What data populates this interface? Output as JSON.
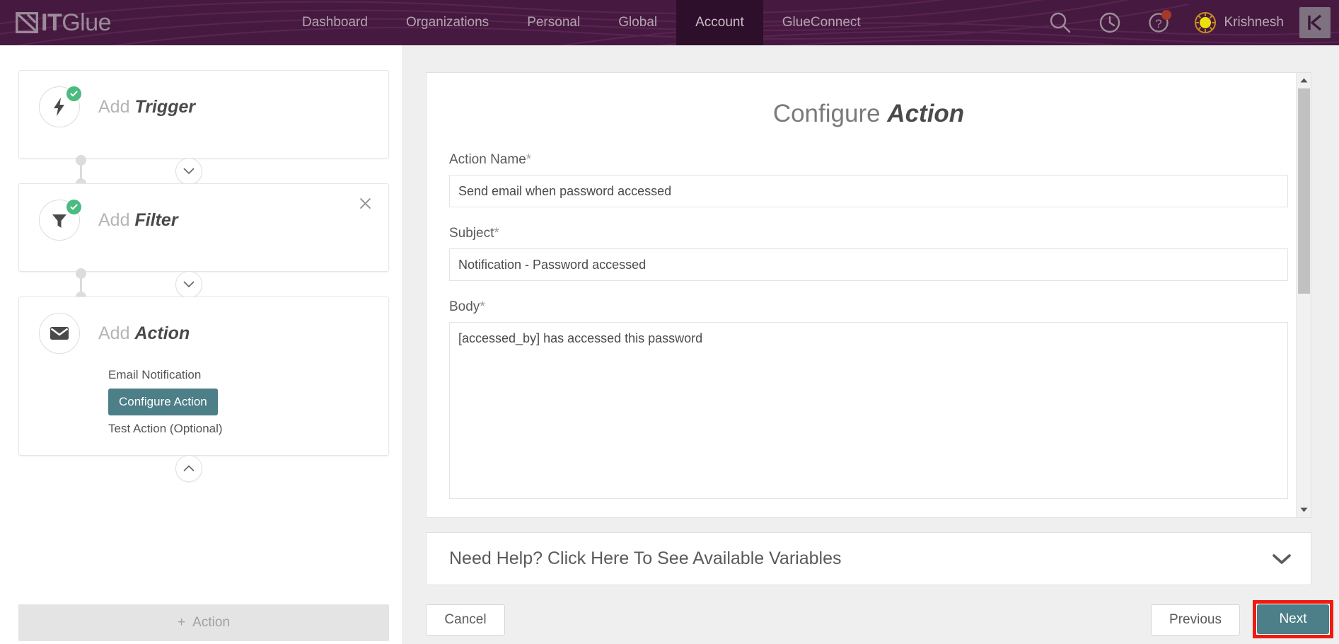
{
  "header": {
    "logo_it": "IT",
    "logo_glue": "Glue",
    "nav": [
      {
        "label": "Dashboard",
        "active": false
      },
      {
        "label": "Organizations",
        "active": false
      },
      {
        "label": "Personal",
        "active": false
      },
      {
        "label": "Global",
        "active": false
      },
      {
        "label": "Account",
        "active": true
      },
      {
        "label": "GlueConnect",
        "active": false
      }
    ],
    "search_icon": "search-icon",
    "history_icon": "clock-icon",
    "help_icon": "question-circle-icon",
    "username": "Krishnesh",
    "app_button_label": "K",
    "bg_color": "#461a40",
    "active_tab_color": "#2e0f2b"
  },
  "sidebar": {
    "steps": [
      {
        "prefix": "Add ",
        "name": "Trigger",
        "icon": "lightning-bolt-icon",
        "completed": true,
        "closable": false,
        "subitems": []
      },
      {
        "prefix": "Add ",
        "name": "Filter",
        "icon": "funnel-icon",
        "completed": true,
        "closable": true,
        "subitems": []
      },
      {
        "prefix": "Add ",
        "name": "Action",
        "icon": "envelope-icon",
        "completed": false,
        "closable": false,
        "subitems": [
          {
            "label": "Email Notification",
            "active": false
          },
          {
            "label": "Configure Action",
            "active": true
          },
          {
            "label": "Test Action (Optional)",
            "active": false
          }
        ]
      }
    ],
    "add_action_label": "Action",
    "add_action_plus": "+",
    "active_subitem_color": "#4c7f87"
  },
  "main": {
    "title_light": "Configure ",
    "title_strong": "Action",
    "fields": [
      {
        "label": "Action Name",
        "required": "*",
        "value": "Send email when password accessed",
        "type": "input"
      },
      {
        "label": "Subject",
        "required": "*",
        "value": "Notification - Password accessed",
        "type": "input"
      },
      {
        "label": "Body",
        "required": "*",
        "value": "[accessed_by] has accessed this password",
        "type": "textarea"
      }
    ],
    "help": {
      "text": "Need Help? Click Here To See Available Variables",
      "chevron": "chevron-down-icon"
    },
    "footer": {
      "cancel": "Cancel",
      "previous": "Previous",
      "next": "Next",
      "next_highlight_color": "#ee1b11",
      "next_bg_color": "#4c7f87"
    }
  }
}
